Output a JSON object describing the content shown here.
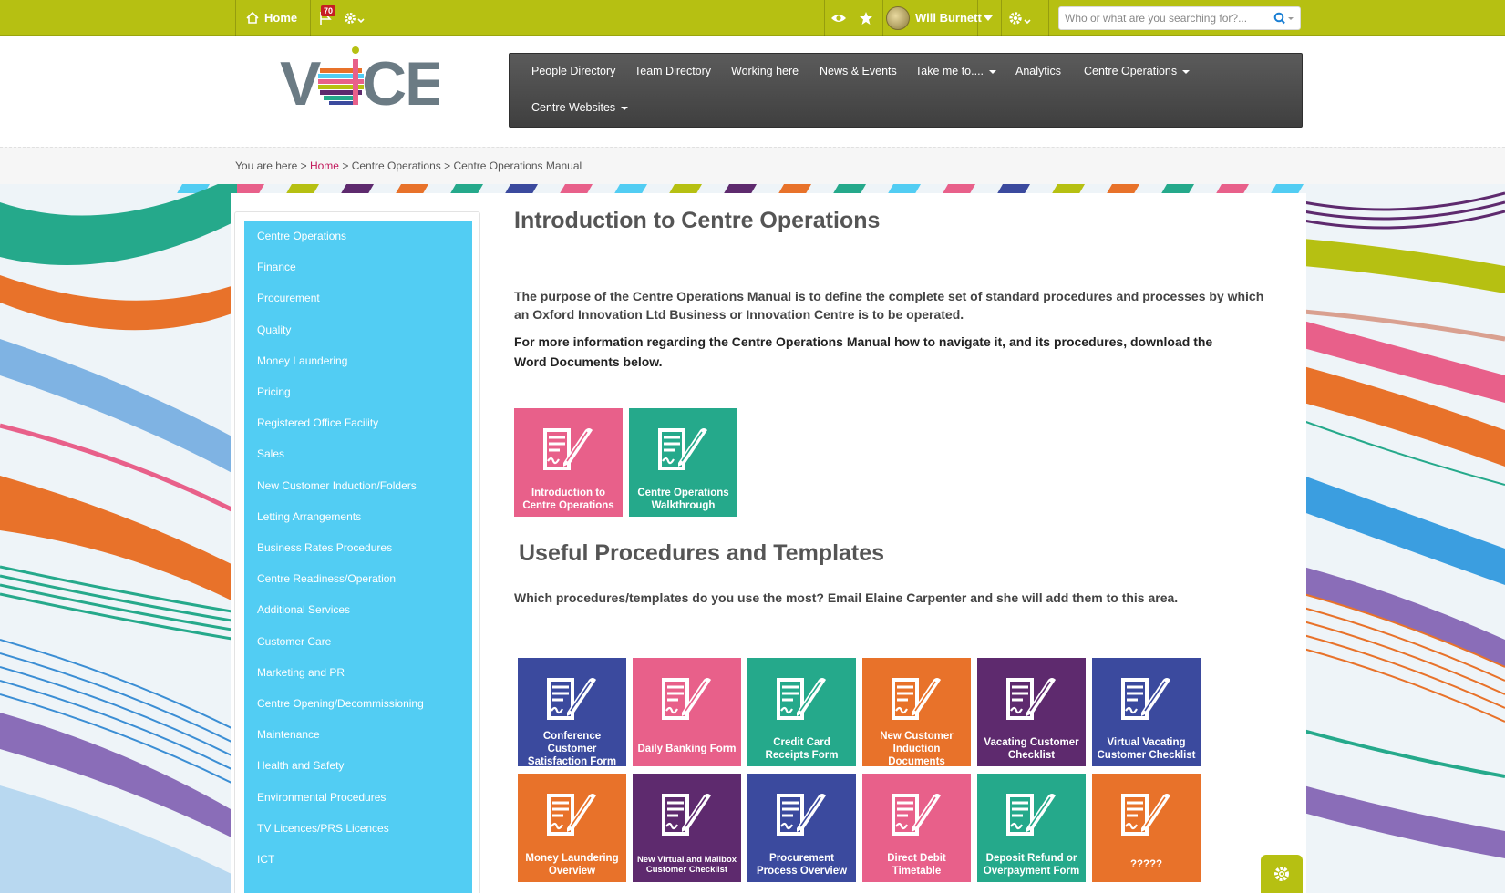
{
  "topbar": {
    "home_label": "Home",
    "notification_count": "70",
    "user_name": "Will Burnett",
    "search_placeholder": "Who or what are you searching for?..."
  },
  "logo": {
    "text": "VOICE"
  },
  "nav": {
    "items": [
      {
        "label": "People Directory",
        "dropdown": false
      },
      {
        "label": "Team Directory",
        "dropdown": false
      },
      {
        "label": "Working here",
        "dropdown": false
      },
      {
        "label": "News & Events",
        "dropdown": false
      },
      {
        "label": "Take me to....",
        "dropdown": true
      },
      {
        "label": "Analytics",
        "dropdown": false
      },
      {
        "label": "Centre Operations",
        "dropdown": true
      },
      {
        "label": "Centre Websites",
        "dropdown": true
      }
    ]
  },
  "breadcrumb": {
    "prefix": "You are here >",
    "home": "Home",
    "sep1": ">",
    "level1": "Centre Operations >",
    "level2": "Centre Operations Manual"
  },
  "sidebar": {
    "items": [
      "Centre Operations",
      "Finance",
      "Procurement",
      "Quality",
      "Money Laundering",
      "Pricing",
      "Registered Office Facility",
      "Sales",
      "New Customer Induction/Folders",
      "Letting Arrangements",
      "Business Rates Procedures",
      "Centre Readiness/Operation",
      "Additional Services",
      "Customer Care",
      "Marketing and PR",
      "Centre Opening/Decommissioning",
      "Maintenance",
      "Health and Safety",
      "Environmental Procedures",
      "TV Licences/PRS Licences",
      "ICT"
    ]
  },
  "main": {
    "intro_title": "Introduction to Centre Operations",
    "intro_p1": "The purpose of the Centre Operations Manual is to define the complete set of standard procedures and processes by which an Oxford Innovation Ltd Business or Innovation Centre is to be operated.",
    "intro_p2": "For more information regarding the Centre Operations Manual how to navigate it, and its procedures, download the Word Documents below.",
    "intro_tiles": [
      {
        "label": "Introduction to Centre Operations",
        "color": "#e8608a"
      },
      {
        "label": "Centre Operations Walkthrough",
        "color": "#25a98b"
      }
    ],
    "useful_title": "Useful Procedures and Templates",
    "useful_p": "Which procedures/templates do you use the most? Email Elaine Carpenter and she will add them to this area.",
    "useful_tiles": [
      {
        "label": "Conference Customer Satisfaction Form",
        "color": "#3b4a9e",
        "small": false
      },
      {
        "label": "Daily Banking Form",
        "color": "#e8608a",
        "small": false
      },
      {
        "label": "Credit Card Receipts Form",
        "color": "#25a98b",
        "small": false
      },
      {
        "label": "New Customer Induction Documents",
        "color": "#e8722a",
        "small": false
      },
      {
        "label": "Vacating Customer Checklist",
        "color": "#5e2a6e",
        "small": false
      },
      {
        "label": "Virtual Vacating Customer Checklist",
        "color": "#3b4a9e",
        "small": false
      },
      {
        "label": "Money Laundering Overview",
        "color": "#e8722a",
        "small": false
      },
      {
        "label": "New Virtual and Mailbox Customer Checklist",
        "color": "#5e2a6e",
        "small": true
      },
      {
        "label": "Procurement Process Overview",
        "color": "#3b4a9e",
        "small": false
      },
      {
        "label": "Direct Debit Timetable",
        "color": "#e8608a",
        "small": false
      },
      {
        "label": "Deposit Refund or Overpayment Form",
        "color": "#25a98b",
        "small": false
      },
      {
        "label": "?????",
        "color": "#e8722a",
        "small": false
      }
    ]
  },
  "colors": {
    "topbar": "#b6c012",
    "sidebar": "#52cdf3",
    "nav": "#4a4a4a",
    "breadcrumb_link": "#c2185b"
  }
}
